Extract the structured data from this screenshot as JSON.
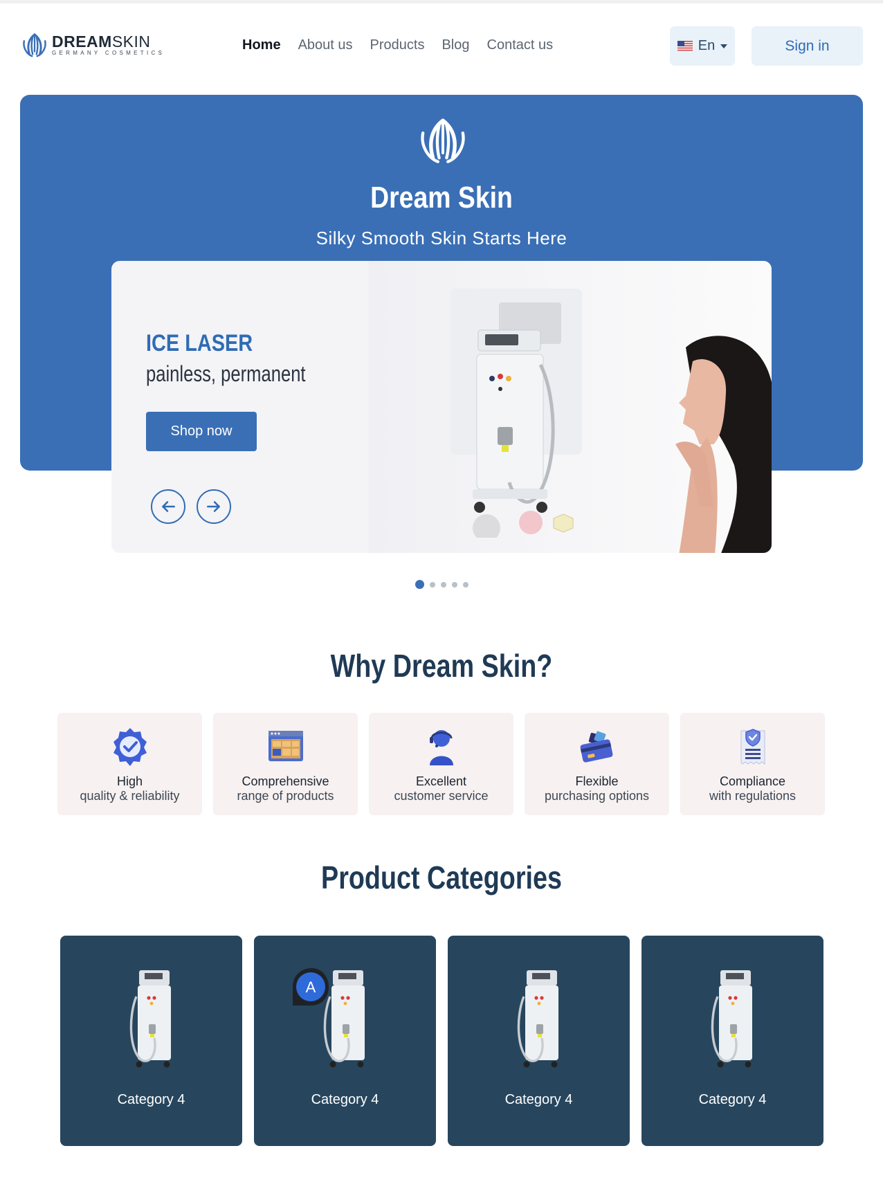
{
  "header": {
    "logo_name_bold": "DREAM",
    "logo_name_rest": "SKIN",
    "logo_tagline": "GERMANY COSMETICS",
    "nav": [
      "Home",
      "About us",
      "Products",
      "Blog",
      "Contact us"
    ],
    "active_nav": "Home",
    "language": "En",
    "sign_in": "Sign in"
  },
  "hero": {
    "title": "Dream Skin",
    "subtitle": "Silky Smooth Skin Starts Here",
    "slide": {
      "title": "ICE LASER",
      "subtitle": "painless, permanent",
      "cta": "Shop now"
    },
    "slide_count": 5,
    "active_slide": 1
  },
  "why": {
    "title_light": "Why ",
    "title_bold": "Dream Skin?",
    "features": [
      {
        "line1": "High",
        "line2": "quality & reliability",
        "icon": "verified-badge-icon"
      },
      {
        "line1": "Comprehensive",
        "line2": "range of products",
        "icon": "product-range-icon"
      },
      {
        "line1": "Excellent",
        "line2": "customer service",
        "icon": "customer-support-icon"
      },
      {
        "line1": "Flexible",
        "line2": "purchasing options",
        "icon": "payment-cards-icon"
      },
      {
        "line1": "Compliance",
        "line2": "with regulations",
        "icon": "compliance-document-icon"
      }
    ]
  },
  "categories": {
    "title_light": "Product ",
    "title_bold": "Categories",
    "items": [
      {
        "label": "Category 4"
      },
      {
        "label": "Category 4"
      },
      {
        "label": "Category 4"
      },
      {
        "label": "Category 4"
      }
    ]
  },
  "cursor_badge": "A",
  "colors": {
    "brand_blue": "#3a6fb6",
    "dark_navy": "#27465e",
    "feature_bg": "#f7f1f1"
  }
}
